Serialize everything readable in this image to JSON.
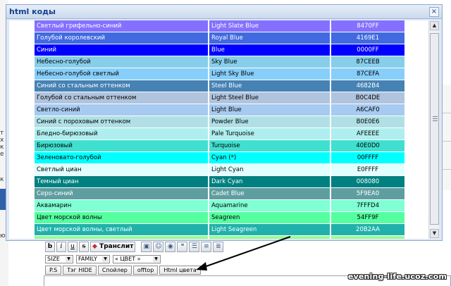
{
  "dialog": {
    "title": "html коды",
    "close_glyph": "×"
  },
  "colors": [
    {
      "ru": "Светлый грифельно-синий",
      "en": "Light Slate Blue",
      "hex": "8470FF",
      "bg": "#8470ff",
      "text": "dark"
    },
    {
      "ru": "Голубой королевский",
      "en": "Royal Blue",
      "hex": "4169E1",
      "bg": "#4169e1",
      "text": "dark"
    },
    {
      "ru": "Синий",
      "en": "Blue",
      "hex": "0000FF",
      "bg": "#0000ff",
      "text": "dark"
    },
    {
      "ru": "Небесно-голубой",
      "en": "Sky Blue",
      "hex": "87CEEB",
      "bg": "#87ceeb",
      "text": "light"
    },
    {
      "ru": "Небесно-голубой светлый",
      "en": "Light Sky Blue",
      "hex": "87CEFA",
      "bg": "#87cefa",
      "text": "light"
    },
    {
      "ru": "Синий со стальным оттенком",
      "en": "Steel Blue",
      "hex": "4682B4",
      "bg": "#4682b4",
      "text": "dark"
    },
    {
      "ru": "Голубой со стальным оттенком",
      "en": "Light Steel Blue",
      "hex": "B0C4DE",
      "bg": "#b0c4de",
      "text": "light"
    },
    {
      "ru": "Светло-синий",
      "en": "Light Blue",
      "hex": "A6CAF0",
      "bg": "#a6caf0",
      "text": "light"
    },
    {
      "ru": "Синий с пороховым оттенком",
      "en": "Powder Blue",
      "hex": "B0E0E6",
      "bg": "#b0e0e6",
      "text": "light"
    },
    {
      "ru": "Бледно-бирюзовый",
      "en": "Pale Turquoise",
      "hex": "AFEEEE",
      "bg": "#afeeee",
      "text": "light"
    },
    {
      "ru": "Бирюзовый",
      "en": "Turquoise",
      "hex": "40E0D0",
      "bg": "#40e0d0",
      "text": "light"
    },
    {
      "ru": "Зеленовато-голубой",
      "en": "Cyan (*)",
      "hex": "00FFFF",
      "bg": "#00ffff",
      "text": "light"
    },
    {
      "ru": "Светлый циан",
      "en": "Light Cyan",
      "hex": "E0FFFF",
      "bg": "#e0ffff",
      "text": "light"
    },
    {
      "ru": "Темный циан",
      "en": "Dark Cyan",
      "hex": "008080",
      "bg": "#008080",
      "text": "dark"
    },
    {
      "ru": "Серо-синий",
      "en": "Cadet Blue",
      "hex": "5F9EA0",
      "bg": "#5f9ea0",
      "text": "dark"
    },
    {
      "ru": "Аквамарин",
      "en": "Aquamarine",
      "hex": "7FFFD4",
      "bg": "#7fffd4",
      "text": "light"
    },
    {
      "ru": "Цвет морской волны",
      "en": "Seagreen",
      "hex": "54FF9F",
      "bg": "#54ff9f",
      "text": "light"
    },
    {
      "ru": "Цвет морской волны, светлый",
      "en": "Light Seagreen",
      "hex": "20B2AA",
      "bg": "#20b2aa",
      "text": "dark"
    },
    {
      "ru": "",
      "en": "",
      "hex": "",
      "bg": "#98fb98",
      "text": "light"
    }
  ],
  "scrollbar": {
    "up": "▲",
    "down": "▼"
  },
  "toolbar": {
    "bold": "b",
    "italic": "i",
    "underline": "u",
    "strike": "s",
    "translit": "Транслит",
    "icons": [
      "image-icon",
      "smiley-icon",
      "swatch-icon",
      "quote-icon",
      "list-icon",
      "align-icon",
      "align-right-icon"
    ],
    "icon_glyphs": [
      "▣",
      "☺",
      "◉",
      "❝",
      "☰",
      "≡",
      "≣"
    ]
  },
  "selects": {
    "size": "SIZE",
    "family": "FAMILY",
    "color": "« ЦВЕТ »"
  },
  "tag_buttons": [
    "P.S",
    "Тэг HIDE",
    "Спойлер",
    "offtop",
    "Html цвета"
  ],
  "watermark": "evening-life.ucoz.com",
  "background": {
    "left_glyphs": [
      "т",
      "х",
      "к",
      "е",
      "к",
      "ю"
    ]
  }
}
